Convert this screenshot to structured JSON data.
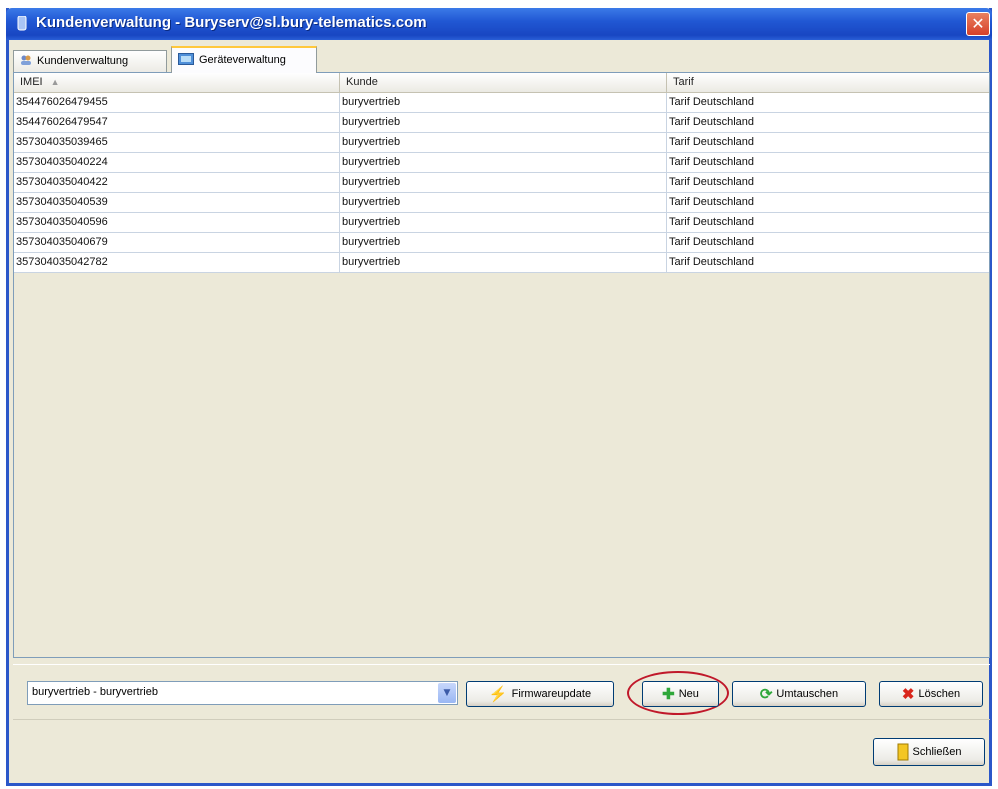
{
  "window": {
    "title": "Kundenverwaltung - Buryserv@sl.bury-telematics.com",
    "close_glyph": "✕"
  },
  "tabs": [
    {
      "label": "Kundenverwaltung",
      "icon": "users-icon",
      "active": false
    },
    {
      "label": "Geräteverwaltung",
      "icon": "device-icon",
      "active": true
    }
  ],
  "table": {
    "columns": [
      "IMEI",
      "Kunde",
      "Tarif"
    ],
    "sort_indicator": "▲",
    "rows": [
      [
        "354476026479455",
        "buryvertrieb",
        "Tarif Deutschland"
      ],
      [
        "354476026479547",
        "buryvertrieb",
        "Tarif Deutschland"
      ],
      [
        "357304035039465",
        "buryvertrieb",
        "Tarif Deutschland"
      ],
      [
        "357304035040224",
        "buryvertrieb",
        "Tarif Deutschland"
      ],
      [
        "357304035040422",
        "buryvertrieb",
        "Tarif Deutschland"
      ],
      [
        "357304035040539",
        "buryvertrieb",
        "Tarif Deutschland"
      ],
      [
        "357304035040596",
        "buryvertrieb",
        "Tarif Deutschland"
      ],
      [
        "357304035040679",
        "buryvertrieb",
        "Tarif Deutschland"
      ],
      [
        "357304035042782",
        "buryvertrieb",
        "Tarif Deutschland"
      ]
    ]
  },
  "toolbar": {
    "customer_select": "buryvertrieb - buryvertrieb",
    "firmware_label": "Firmwareupdate",
    "new_label": "Neu",
    "swap_label": "Umtauschen",
    "delete_label": "Löschen"
  },
  "footer": {
    "close_label": "Schließen"
  },
  "colors": {
    "titlebar": "#2158d4",
    "highlight_ring": "#c0182a",
    "panel": "#ece9d8"
  }
}
